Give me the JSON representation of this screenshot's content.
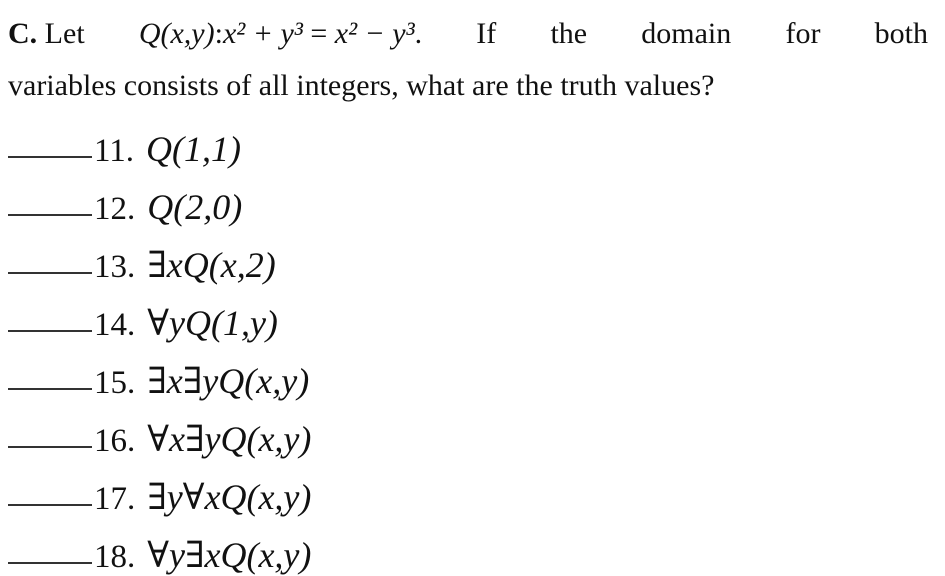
{
  "problem": {
    "label": "C.",
    "let_word": "Let",
    "predicate": "Q(x,y)",
    "colon": ":",
    "equation_lhs": "x² + y³",
    "equals": "=",
    "equation_rhs": "x² − y³",
    "period": ".",
    "line1_tail": [
      "If",
      "the",
      "domain",
      "for",
      "both"
    ],
    "line2": "variables consists of all integers, what are the truth values?"
  },
  "items": [
    {
      "number": "11.",
      "expression": "Q(1,1)",
      "answer": ""
    },
    {
      "number": "12.",
      "expression": "Q(2,0)",
      "answer": ""
    },
    {
      "number": "13.",
      "expression": "∃xQ(x,2)",
      "answer": ""
    },
    {
      "number": "14.",
      "expression": "∀yQ(1,y)",
      "answer": ""
    },
    {
      "number": "15.",
      "expression": "∃x∃yQ(x,y)",
      "answer": ""
    },
    {
      "number": "16.",
      "expression": "∀x∃yQ(x,y)",
      "answer": ""
    },
    {
      "number": "17.",
      "expression": "∃y∀xQ(x,y)",
      "answer": ""
    },
    {
      "number": "18.",
      "expression": "∀y∃xQ(x,y)",
      "answer": ""
    }
  ]
}
